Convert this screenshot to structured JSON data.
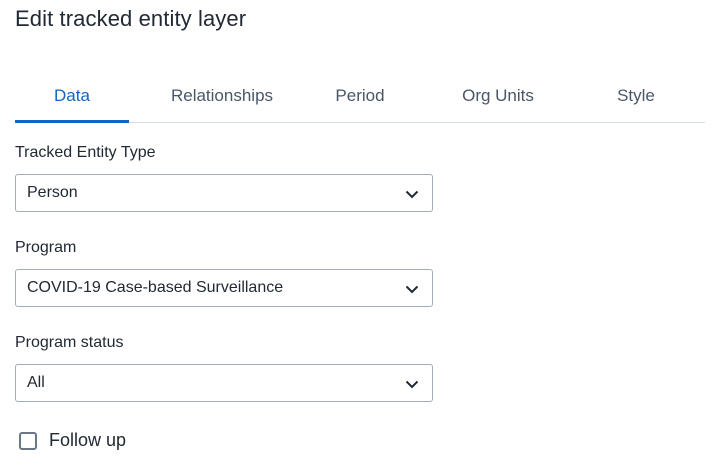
{
  "dialog": {
    "title": "Edit tracked entity layer"
  },
  "tabs": [
    {
      "label": "Data",
      "active": true
    },
    {
      "label": "Relationships",
      "active": false
    },
    {
      "label": "Period",
      "active": false
    },
    {
      "label": "Org Units",
      "active": false
    },
    {
      "label": "Style",
      "active": false
    }
  ],
  "fields": {
    "tracked_entity_type": {
      "label": "Tracked Entity Type",
      "value": "Person"
    },
    "program": {
      "label": "Program",
      "value": "COVID-19 Case-based Surveillance"
    },
    "program_status": {
      "label": "Program status",
      "value": "All"
    },
    "follow_up": {
      "label": "Follow up",
      "checked": false
    }
  },
  "colors": {
    "accent": "#1565c0",
    "text": "#212934",
    "muted_text": "#4a5768",
    "border": "#a0adba",
    "divider": "#d5dde5"
  }
}
